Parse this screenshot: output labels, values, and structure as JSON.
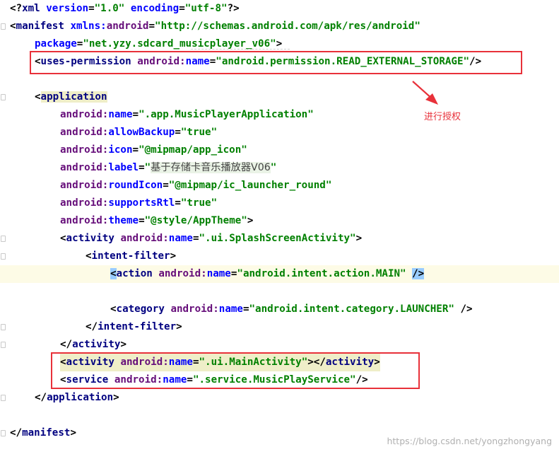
{
  "editor": {
    "lines": {
      "l1": {
        "open": "<?",
        "tag": "xml",
        "a1": "version",
        "v1": "\"1.0\"",
        "a2": "encoding",
        "v2": "\"utf-8\"",
        "close": "?>"
      },
      "l2": {
        "open": "<",
        "tag": "manifest",
        "ns": "xmlns:",
        "attr": "android",
        "eq": "=",
        "val": "\"http://schemas.android.com/apk/res/android\""
      },
      "l3": {
        "attr": "package",
        "eq": "=",
        "val": "\"net.yzy.sdcard_musicplayer_v06\"",
        "close": ">"
      },
      "l4": {
        "open": "<",
        "tag": "uses-permission",
        "ns": "android:",
        "attr": "name",
        "eq": "=",
        "val": "\"android.permission.READ_EXTERNAL_STORAGE\"",
        "close": "/>"
      },
      "l6": {
        "open": "<",
        "tag": "application"
      },
      "l7": {
        "ns": "android:",
        "attr": "name",
        "eq": "=",
        "val": "\".app.MusicPlayerApplication\""
      },
      "l8": {
        "ns": "android:",
        "attr": "allowBackup",
        "eq": "=",
        "val": "\"true\""
      },
      "l9": {
        "ns": "android:",
        "attr": "icon",
        "eq": "=",
        "val": "\"@mipmap/app_icon\""
      },
      "l10": {
        "ns": "android:",
        "attr": "label",
        "eq": "=",
        "q1": "\"",
        "cjk": "基于存储卡音乐播放器V06",
        "q2": "\""
      },
      "l11": {
        "ns": "android:",
        "attr": "roundIcon",
        "eq": "=",
        "val": "\"@mipmap/ic_launcher_round\""
      },
      "l12": {
        "ns": "android:",
        "attr": "supportsRtl",
        "eq": "=",
        "val": "\"true\""
      },
      "l13": {
        "ns": "android:",
        "attr": "theme",
        "eq": "=",
        "val": "\"@style/AppTheme\"",
        "close": ">"
      },
      "l14": {
        "open": "<",
        "tag": "activity",
        "ns": "android:",
        "attr": "name",
        "eq": "=",
        "val": "\".ui.SplashScreenActivity\"",
        "close": ">"
      },
      "l15": {
        "open": "<",
        "tag": "intent-filter",
        "close": ">"
      },
      "l16": {
        "open": "<",
        "tag": "action",
        "ns": "android:",
        "attr": "name",
        "eq": "=",
        "val": "\"android.intent.action.MAIN\"",
        "close": "/>"
      },
      "l18": {
        "open": "<",
        "tag": "category",
        "ns": "android:",
        "attr": "name",
        "eq": "=",
        "val": "\"android.intent.category.LAUNCHER\"",
        "close": "/>"
      },
      "l19": {
        "open": "</",
        "tag": "intent-filter",
        "close": ">"
      },
      "l20": {
        "open": "</",
        "tag": "activity",
        "close": ">"
      },
      "l21": {
        "open": "<",
        "tag": "activity",
        "ns": "android:",
        "attr": "name",
        "eq": "=",
        "val": "\".ui.MainActivity\"",
        "mid": "></",
        "tag2": "activity",
        "close": ">"
      },
      "l22": {
        "open": "<",
        "tag": "service",
        "ns": "android:",
        "attr": "name",
        "eq": "=",
        "val": "\".service.MusicPlayService\"",
        "close": "/>"
      },
      "l23": {
        "open": "</",
        "tag": "application",
        "close": ">"
      },
      "l25": {
        "open": "</",
        "tag": "manifest",
        "close": ">"
      }
    }
  },
  "annotation": {
    "label": "进行授权",
    "color": "#e8313a"
  },
  "watermark": "https://blog.csdn.net/yongzhongyang",
  "colors": {
    "tag": "#000080",
    "namespace": "#660e7a",
    "attribute": "#0000ff",
    "value": "#008000"
  }
}
